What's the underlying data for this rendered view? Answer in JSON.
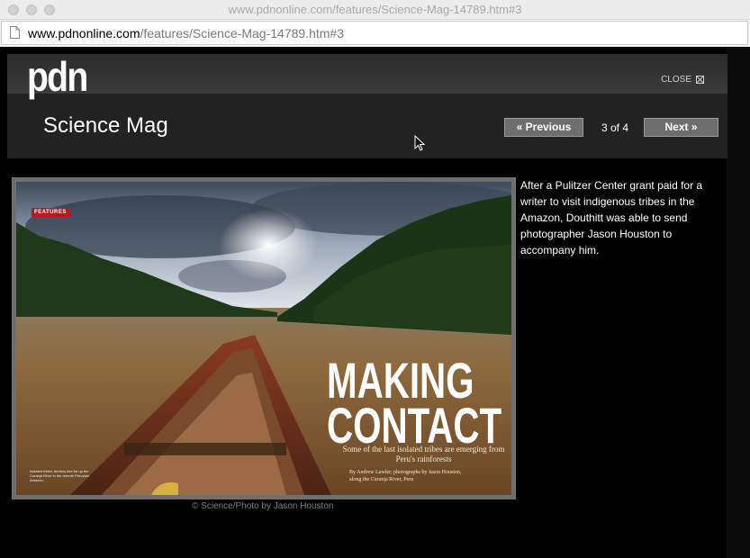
{
  "browser": {
    "window_title": "www.pdnonline.com/features/Science-Mag-14789.htm#3",
    "url_domain": "www.pdnonline.com",
    "url_path": "/features/Science-Mag-14789.htm#3"
  },
  "header": {
    "logo": "pdn",
    "close_label": "CLOSE",
    "gallery_title": "Science Mag",
    "prev_label": "« Previous",
    "counter": "3 of 4",
    "next_label": "Next »"
  },
  "photo": {
    "badge": "FEATURES",
    "headline_line1": "MAKING",
    "headline_line2": "CONTACT",
    "subhead": "Some of the last isolated tribes are emerging from Peru's rainforests",
    "byline_line1": "By Andrew Lawler; photographs by Jason Houston,",
    "byline_line2": "along the Curanja River, Peru",
    "tiny_caption": "Isolated tribes' territory lies far up the Curanja River in the remote Peruvian Amazon.",
    "credit": "© Science/Photo by Jason Houston"
  },
  "caption": "After a Pulitzer Center grant paid for a writer to visit indigenous tribes in the Amazon, Douthitt was able to send photographer Jason Houston to accompany him.",
  "colors": {
    "badge_red": "#c2141b",
    "nav_button": "#6e6e6e",
    "header_bg": "#222222"
  }
}
